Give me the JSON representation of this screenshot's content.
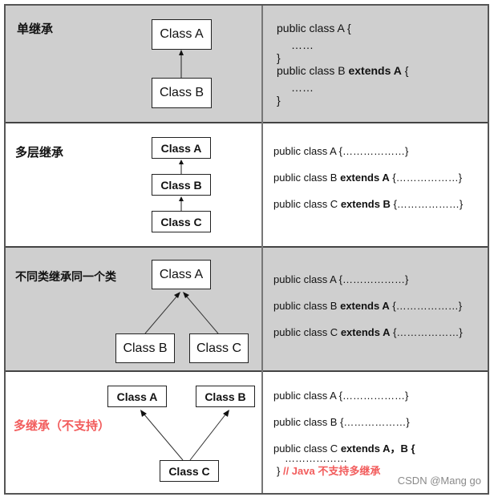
{
  "rows": [
    {
      "title": "单继承",
      "classes": [
        "Class A",
        "Class B"
      ],
      "code": {
        "line1": "public class A {",
        "line2": "……",
        "line3": "}",
        "line4_pre": "public class B ",
        "line4_kw": "extends A",
        "line4_post": " {",
        "line5": "……",
        "line6": "}"
      }
    },
    {
      "title": "多层继承",
      "classes": [
        "Class A",
        "Class B",
        "Class C"
      ],
      "code": {
        "line1": "public class A {………………}",
        "line2_pre": "public class B ",
        "line2_kw": "extends A",
        "line2_post": " {………………}",
        "line3_pre": "public class C ",
        "line3_kw": "extends B",
        "line3_post": " {………………}"
      }
    },
    {
      "title": "不同类继承同一个类",
      "classes": [
        "Class A",
        "Class B",
        "Class C"
      ],
      "code": {
        "line1": "public class A {………………}",
        "line2_pre": "public class B ",
        "line2_kw": "extends A",
        "line2_post": " {………………}",
        "line3_pre": "public class C ",
        "line3_kw": "extends A",
        "line3_post": " {………………}"
      }
    },
    {
      "title": "多继承（不支持）",
      "classes": [
        "Class A",
        "Class B",
        "Class C"
      ],
      "code": {
        "line1": "public class A {………………}",
        "line2": "public class B {………………}",
        "line3_pre": "public class C ",
        "line3_kw": "extends A，B {",
        "line4": "………………",
        "line5_pre": "}",
        "line5_comment": "// Java 不支持多继承"
      }
    }
  ],
  "watermark": "CSDN @Mang go",
  "colors": {
    "gray_row": "#cfcfcf",
    "white_row": "#ffffff",
    "unsupported_red": "#f25c5c"
  }
}
